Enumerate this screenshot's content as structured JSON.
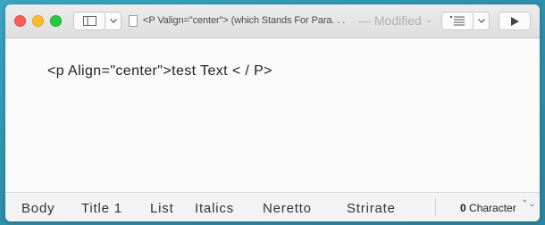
{
  "titlebar": {
    "document_title": "<P Valign=\"center\"> (which Stands For Para. . .",
    "status": "— Modified",
    "status_chevron": "⌄"
  },
  "editor": {
    "text": "<p Align=\"center\">test Text < / P>"
  },
  "footer": {
    "styles": [
      "Body",
      "Title 1",
      "List",
      "Italics",
      "Neretto",
      "Strirate"
    ],
    "count_value": "0",
    "count_unit": "Character",
    "stepper": "⌃⌄"
  },
  "colors": {
    "desktop": "#2f92ad",
    "close": "#fd5f57",
    "minimize": "#febc2e",
    "maximize": "#28c840"
  },
  "icons": [
    "sidebar-icon",
    "chevron-down-icon",
    "document-icon",
    "list-format-icon",
    "play-icon"
  ]
}
